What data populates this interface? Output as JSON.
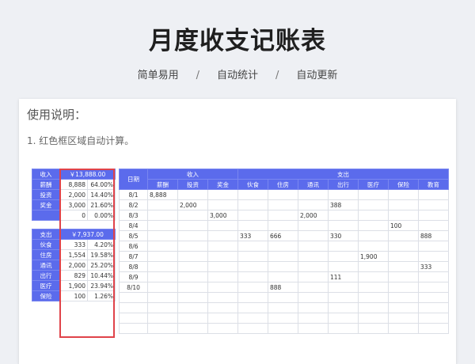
{
  "header": {
    "title": "月度收支记账表",
    "tags": [
      "简单易用",
      "自动统计",
      "自动更新"
    ],
    "sep": "/"
  },
  "usage": {
    "heading": "使用说明：",
    "note": "1. 红色框区域自动计算。"
  },
  "colors": {
    "header_bg": "#5b6bec",
    "highlight": "#e0434a"
  },
  "summary": {
    "income_label": "收入",
    "income_total": "￥13,888.00",
    "income_rows": [
      {
        "name": "薪酬",
        "amount": "8,888",
        "pct": "64.00%"
      },
      {
        "name": "投资",
        "amount": "2,000",
        "pct": "14.40%"
      },
      {
        "name": "奖金",
        "amount": "3,000",
        "pct": "21.60%"
      },
      {
        "name": "",
        "amount": "0",
        "pct": "0.00%"
      }
    ],
    "expense_label": "支出",
    "expense_total": "￥7,937.00",
    "expense_rows": [
      {
        "name": "伙食",
        "amount": "333",
        "pct": "4.20%"
      },
      {
        "name": "住房",
        "amount": "1,554",
        "pct": "19.58%"
      },
      {
        "name": "通讯",
        "amount": "2,000",
        "pct": "25.20%"
      },
      {
        "name": "出行",
        "amount": "829",
        "pct": "10.44%"
      },
      {
        "name": "医疗",
        "amount": "1,900",
        "pct": "23.94%"
      },
      {
        "name": "保险",
        "amount": "100",
        "pct": "1.26%"
      }
    ]
  },
  "ledger": {
    "date_label": "日期",
    "income_label": "收入",
    "expense_label": "支出",
    "income_cols": [
      "薪酬",
      "投资",
      "奖金"
    ],
    "expense_cols": [
      "伙食",
      "住房",
      "通讯",
      "出行",
      "医疗",
      "保险",
      "教育"
    ],
    "rows": [
      [
        "8/1",
        "8,888",
        "",
        "",
        "",
        "",
        "",
        "",
        "",
        "",
        ""
      ],
      [
        "8/2",
        "",
        "2,000",
        "",
        "",
        "",
        "",
        "388",
        "",
        "",
        ""
      ],
      [
        "8/3",
        "",
        "",
        "3,000",
        "",
        "",
        "2,000",
        "",
        "",
        "",
        ""
      ],
      [
        "8/4",
        "",
        "",
        "",
        "",
        "",
        "",
        "",
        "",
        "100",
        ""
      ],
      [
        "8/5",
        "",
        "",
        "",
        "333",
        "666",
        "",
        "330",
        "",
        "",
        "888"
      ],
      [
        "8/6",
        "",
        "",
        "",
        "",
        "",
        "",
        "",
        "",
        "",
        ""
      ],
      [
        "8/7",
        "",
        "",
        "",
        "",
        "",
        "",
        "",
        "1,900",
        "",
        ""
      ],
      [
        "8/8",
        "",
        "",
        "",
        "",
        "",
        "",
        "",
        "",
        "",
        "333"
      ],
      [
        "8/9",
        "",
        "",
        "",
        "",
        "",
        "",
        "111",
        "",
        "",
        ""
      ],
      [
        "8/10",
        "",
        "",
        "",
        "",
        "888",
        "",
        "",
        "",
        "",
        ""
      ],
      [
        "",
        "",
        "",
        "",
        "",
        "",
        "",
        "",
        "",
        "",
        ""
      ],
      [
        "",
        "",
        "",
        "",
        "",
        "",
        "",
        "",
        "",
        "",
        ""
      ],
      [
        "",
        "",
        "",
        "",
        "",
        "",
        "",
        "",
        "",
        "",
        ""
      ],
      [
        "",
        "",
        "",
        "",
        "",
        "",
        "",
        "",
        "",
        "",
        ""
      ]
    ]
  }
}
